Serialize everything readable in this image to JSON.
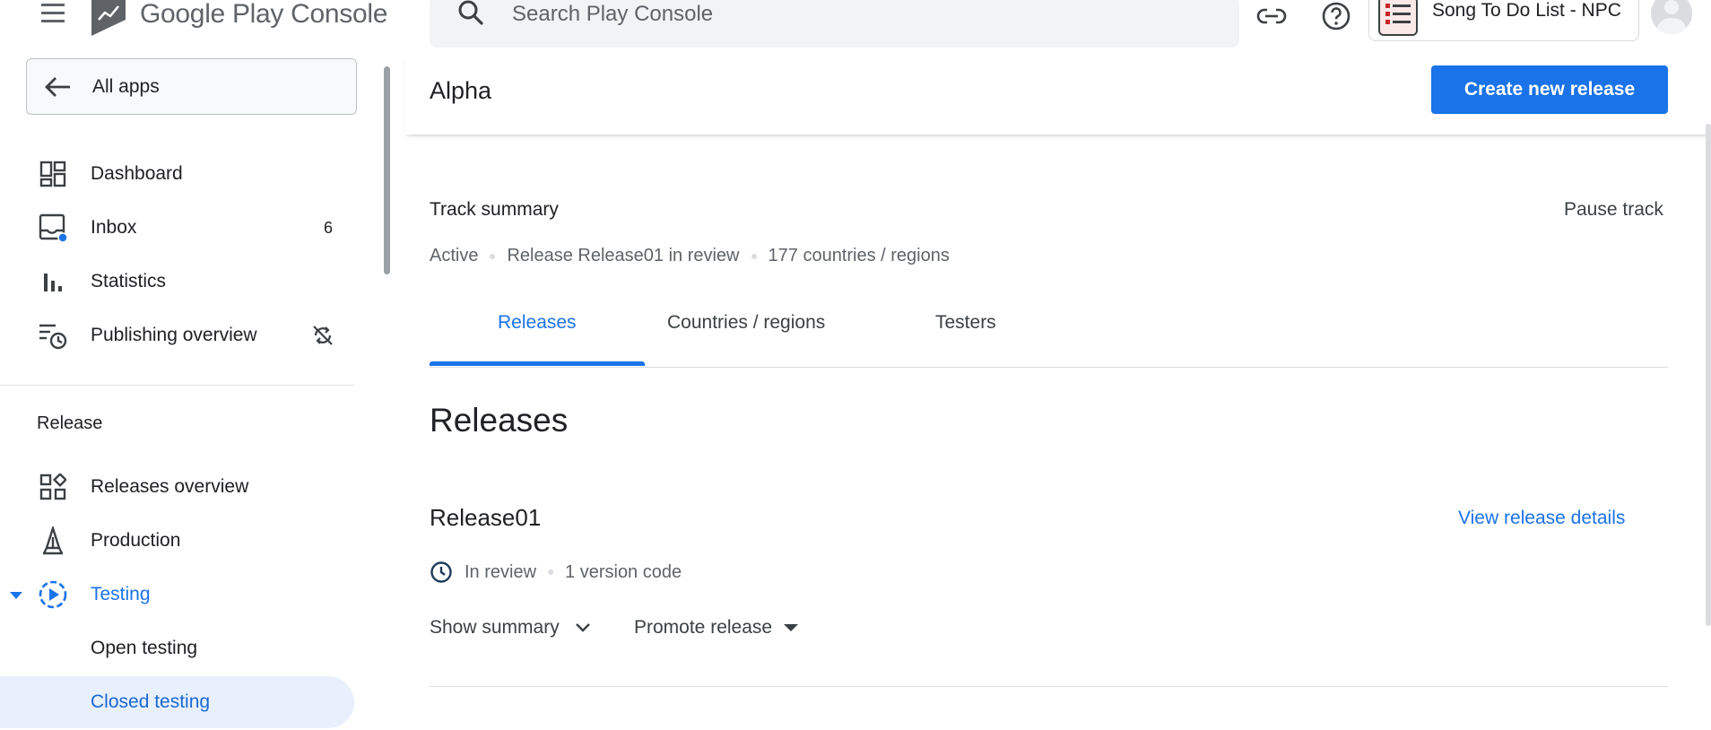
{
  "header": {
    "logo_text": "Google Play Console",
    "search_placeholder": "Search Play Console",
    "app_name": "Song To Do List - NPC"
  },
  "sidebar": {
    "all_apps_label": "All apps",
    "items": [
      {
        "label": "Dashboard"
      },
      {
        "label": "Inbox",
        "badge": "6"
      },
      {
        "label": "Statistics"
      },
      {
        "label": "Publishing overview"
      }
    ],
    "section_title": "Release",
    "release_items": [
      {
        "label": "Releases overview"
      },
      {
        "label": "Production"
      },
      {
        "label": "Testing"
      },
      {
        "label": "Open testing"
      },
      {
        "label": "Closed testing"
      }
    ]
  },
  "main": {
    "title": "Alpha",
    "create_button": "Create new release",
    "track_summary": "Track summary",
    "pause_track": "Pause track",
    "status": {
      "state": "Active",
      "release_state": "Release Release01 in review",
      "countries": "177 countries / regions"
    },
    "tabs": [
      {
        "label": "Releases"
      },
      {
        "label": "Countries / regions"
      },
      {
        "label": "Testers"
      }
    ],
    "releases_heading": "Releases",
    "release": {
      "name": "Release01",
      "view_details": "View release details",
      "review_status": "In review",
      "version_codes": "1 version code",
      "show_summary": "Show summary",
      "promote_release": "Promote release"
    }
  },
  "colors": {
    "accent": "#1a73e8",
    "selected_bg": "#e8f0fe",
    "text_primary": "#202124",
    "text_secondary": "#5f6368"
  }
}
